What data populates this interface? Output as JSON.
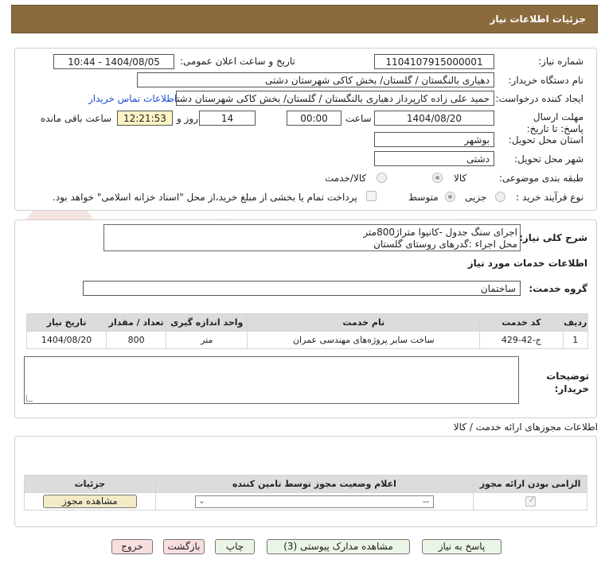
{
  "header": {
    "title": "جزئیات اطلاعات نیاز"
  },
  "form": {
    "need_number_label": "شماره نیاز:",
    "need_number": "1104107915000001",
    "announce_label": "تاریخ و ساعت اعلان عمومی:",
    "announce_value": "1404/08/05 - 10:44",
    "buyer_org_label": "نام دستگاه خریدار:",
    "buyer_org": "دهیاری بالنگستان / گلستان/ بخش کاکی شهرستان دشتی",
    "creator_label": "ایجاد کننده درخواست:",
    "creator": "حمید علی زاده کارپرداز دهیاری بالنگستان / گلستان/ بخش کاکی شهرستان دشتی",
    "contact_link": "اطلاعات تماس خریدار",
    "deadline_label": "مهلت ارسال پاسخ: تا تاریخ:",
    "deadline_date": "1404/08/20",
    "time_label": "ساعت",
    "deadline_time": "00:00",
    "days_value": "14",
    "days_label": "روز و",
    "remaining_time": "12:21:53",
    "remaining_label": "ساعت باقی مانده",
    "province_label": "استان محل تحویل:",
    "province": "بوشهر",
    "city_label": "شهر محل تحویل:",
    "city": "دشتی",
    "category_label": "طبقه بندی موضوعی:",
    "category_options": [
      "کالا",
      "کالا/خدمت"
    ],
    "purchase_type_label": "نوع فرآیند خرید :",
    "purchase_options": [
      "جزیی",
      "متوسط"
    ],
    "payment_note": "پرداخت تمام یا بخشی از مبلغ خرید،از محل \"اسناد خزانه اسلامی\" خواهد بود."
  },
  "summary": {
    "label": "شرح کلی نیاز:",
    "line1": "اجرای سنگ جدول -کانیوا متراژ800متر",
    "line2": "محل اجراء :گدرهای روستای گلستان"
  },
  "services": {
    "section_title": "اطلاعات خدمات مورد نیاز",
    "group_label": "گروه خدمت:",
    "group_value": "ساختمان",
    "columns": [
      "ردیف",
      "کد خدمت",
      "نام خدمت",
      "واحد اندازه گیری",
      "تعداد / مقدار",
      "تاریخ نیاز"
    ],
    "rows": [
      [
        "1",
        "ج-42-429",
        "ساخت سایر پروژه‌های مهندسی عمران",
        "متر",
        "800",
        "1404/08/20"
      ]
    ]
  },
  "buyer_notes": {
    "label": "توضیحات خریدار:"
  },
  "permits": {
    "section_title": "اطلاعات مجوزهای ارائه خدمت / کالا",
    "columns": [
      "الزامی بودن ارائه مجوز",
      "اعلام وضعیت مجوز توسط تامین کننده",
      "جزئیات"
    ],
    "select_value": "--",
    "view_button": "مشاهده مجوز"
  },
  "footer": {
    "reply": "پاسخ به نیاز",
    "attachments": "مشاهده مدارک پیوستی (3)",
    "print": "چاپ",
    "back": "بازگشت",
    "exit": "خروج"
  },
  "colors": {
    "header": "#8b6a3e",
    "table_header": "#dcdcdc",
    "link": "#1d4fd1"
  }
}
